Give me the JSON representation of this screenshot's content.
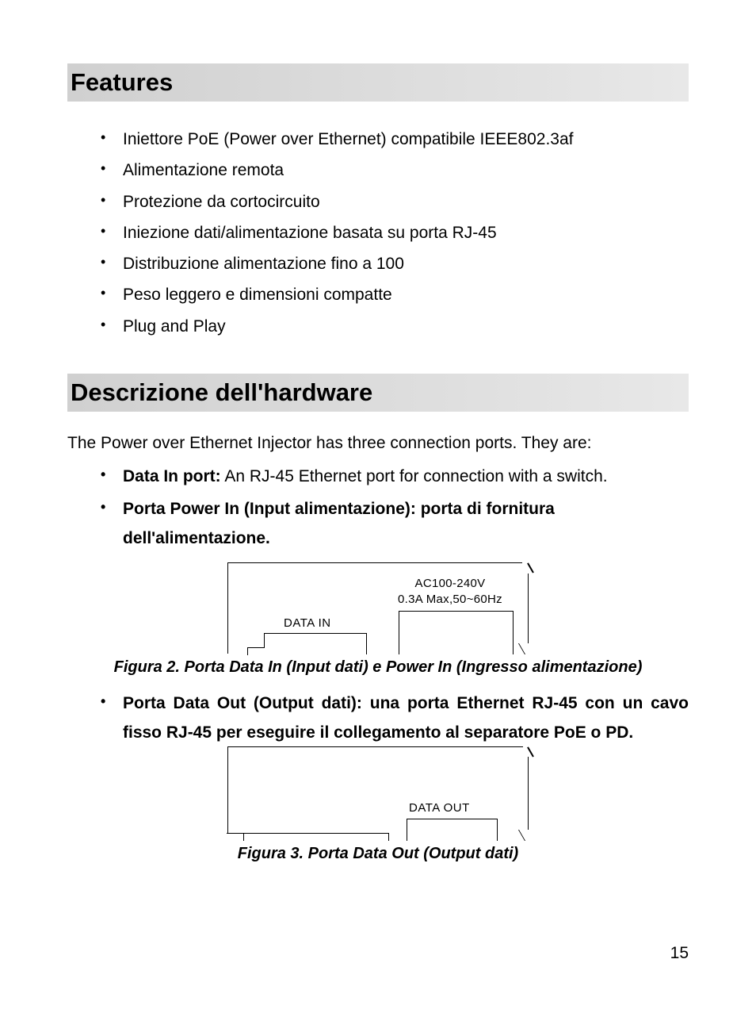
{
  "sections": {
    "features": {
      "title": "Features",
      "items": [
        "Iniettore PoE (Power over Ethernet) compatibile IEEE802.3af",
        "Alimentazione remota",
        "Protezione da cortocircuito",
        "Iniezione dati/alimentazione basata su porta RJ-45",
        "Distribuzione alimentazione fino a 100",
        "Peso leggero e dimensioni compatte",
        "Plug and Play"
      ]
    },
    "hardware": {
      "title": "Descrizione dell'hardware",
      "intro": "The Power over Ethernet Injector has three connection ports. They are:",
      "items": [
        {
          "bold": "Data In port:",
          "rest": " An RJ-45 Ethernet port for connection with a switch."
        },
        {
          "bold": "Porta Power In (Input alimentazione): porta di fornitura dell'alimentazione.",
          "rest": ""
        },
        {
          "bold": "Porta Data Out (Output dati): una porta Ethernet RJ-45 con un cavo fisso RJ-45 per eseguire il collegamento al separatore PoE o PD.",
          "rest": ""
        }
      ]
    }
  },
  "figures": {
    "fig2": {
      "data_in_label": "DATA IN",
      "ac_line1": "AC100-240V",
      "ac_line2": "0.3A Max,50~60Hz",
      "caption": "Figura 2. Porta Data In (Input dati) e Power In (Ingresso alimentazione)"
    },
    "fig3": {
      "data_out_label": "DATA OUT",
      "caption": "Figura 3. Porta Data Out (Output dati)"
    }
  },
  "page_number": "15"
}
